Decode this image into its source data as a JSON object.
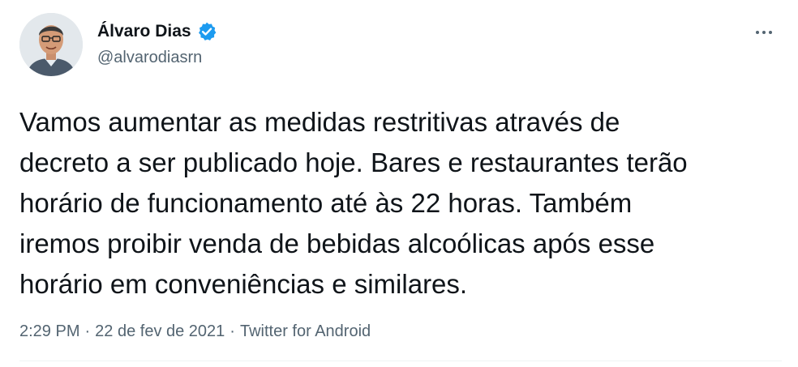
{
  "author": {
    "display_name": "Álvaro Dias",
    "handle": "@alvarodiasrn",
    "verified_icon": "verified-badge-icon",
    "avatar_icon": "profile-photo"
  },
  "tweet": {
    "text": "Vamos aumentar as medidas restritivas através de\ndecreto a ser publicado hoje. Bares e restaurantes terão\nhorário de funcionamento até às 22 horas. Também\niremos proibir venda de bebidas alcoólicas após esse\nhorário em conveniências e similares."
  },
  "meta": {
    "time": "2:29 PM",
    "separator": "·",
    "date": "22 de fev de 2021",
    "source": "Twitter for Android"
  },
  "menu": {
    "icon": "more-options-icon"
  },
  "colors": {
    "text": "#0f1419",
    "secondary": "#536471",
    "verified": "#1d9bf0"
  }
}
